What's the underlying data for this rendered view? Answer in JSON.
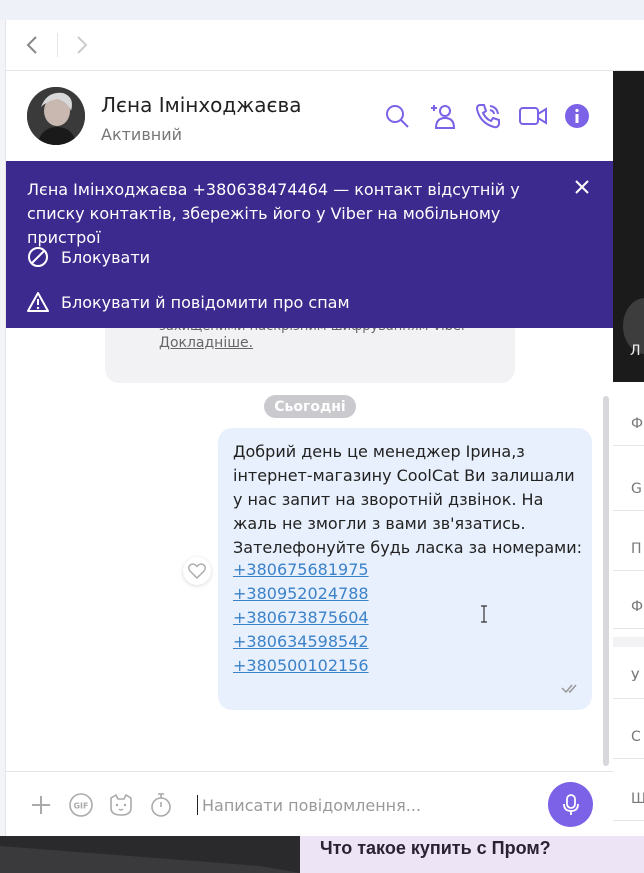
{
  "nav": {
    "back_icon": "chevron-left-icon",
    "forward_icon": "chevron-right-icon"
  },
  "header": {
    "contact_name": "Лєна Імінходжаєва",
    "status": "Активний",
    "icons": [
      "search-icon",
      "add-participant-icon",
      "phone-icon",
      "video-call-icon",
      "info-icon"
    ],
    "accent_color": "#7c62e6"
  },
  "banner": {
    "text": "Лєна Імінходжаєва +380638474464 — контакт відсутній у списку контактів, збережіть його у Viber на мобільному пристрої",
    "block_label": "Блокувати",
    "block_spam_label": "Блокувати й повідомити про спам",
    "background_color": "#3d2a8e"
  },
  "encryption_notice": {
    "text": "захищеними наскрізним шифруванням Viber",
    "link": "Докладніше."
  },
  "date_separator": "Сьогодні",
  "message": {
    "text": "Добрий день це менеджер Ірина,з інтернет-магазину  CoolCat Ви залишали у нас запит на зворотній дзвінок. На жаль не змогли з вами зв'язатись. Зателефонуйте будь ласка за номерами:",
    "phones": [
      "+380675681975",
      "+380952024788",
      "+380673875604",
      "+380634598542",
      "+380500102156"
    ],
    "status_icon": "delivered-check-icon"
  },
  "composer": {
    "placeholder": "Написати повідомлення...",
    "icons": [
      "plus-icon",
      "gif-icon",
      "sticker-icon",
      "timer-icon",
      "microphone-icon"
    ]
  },
  "right_panel": {
    "photo_letter": "Л",
    "rows": [
      "Ф",
      "G",
      "П",
      "Ф",
      "У",
      "С",
      "Щ"
    ]
  },
  "background_page": {
    "headline": "Что такое купить с Пром?"
  }
}
